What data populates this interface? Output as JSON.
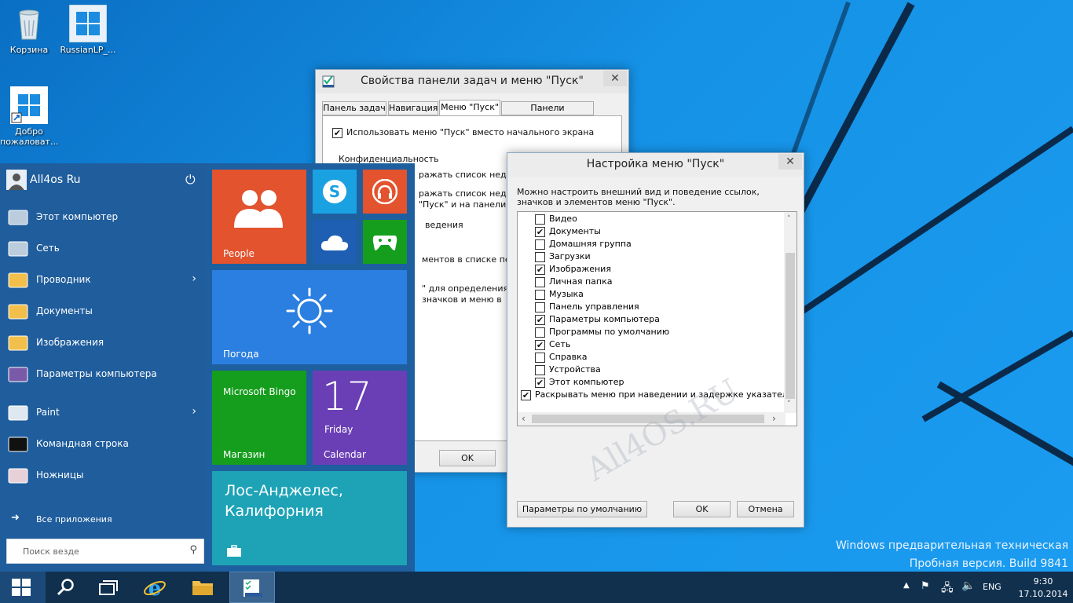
{
  "desktop": {
    "icons": [
      {
        "label": "Корзина"
      },
      {
        "label": "RussianLP_..."
      },
      {
        "label": "Добро пожаловат..."
      }
    ],
    "watermark_line1": "Windows предварительная техническая",
    "watermark_line2": "Пробная версия. Build 9841"
  },
  "taskbar_props": {
    "title": "Свойства панели задач и меню \"Пуск\"",
    "tabs": [
      "Панель задач",
      "Навигация",
      "Меню \"Пуск\"",
      "Панели инструментов"
    ],
    "use_start_menu": "Использовать меню \"Пуск\" вместо начального экрана",
    "privacy": "Конфиденциальность",
    "line1": "ражать список недавно",
    "line2": "ражать список недавно",
    "line3": "\"Пуск\" и на панели з",
    "line4": "ведения",
    "line5": "ментов в списке перех",
    "line6": "\" для определения вне",
    "line7": "значков и меню в",
    "ok": "OK"
  },
  "customize": {
    "title": "Настройка меню \"Пуск\"",
    "description": "Можно настроить внешний вид и поведение ссылок, значков и элементов меню \"Пуск\".",
    "items": [
      {
        "label": "Видео",
        "checked": false
      },
      {
        "label": "Документы",
        "checked": true
      },
      {
        "label": "Домашняя группа",
        "checked": false
      },
      {
        "label": "Загрузки",
        "checked": false
      },
      {
        "label": "Изображения",
        "checked": true
      },
      {
        "label": "Личная папка",
        "checked": false
      },
      {
        "label": "Музыка",
        "checked": false
      },
      {
        "label": "Панель управления",
        "checked": false
      },
      {
        "label": "Параметры компьютера",
        "checked": true
      },
      {
        "label": "Программы по умолчанию",
        "checked": false
      },
      {
        "label": "Сеть",
        "checked": true
      },
      {
        "label": "Справка",
        "checked": false
      },
      {
        "label": "Устройства",
        "checked": false
      },
      {
        "label": "Этот компьютер",
        "checked": true
      }
    ],
    "hover_option": "Раскрывать меню при наведении и задержке указателя мыши",
    "defaults_button": "Параметры по умолчанию",
    "ok": "OK",
    "cancel": "Отмена",
    "site_watermark": "All4OS.RU"
  },
  "start": {
    "user": "All4os Ru",
    "items": [
      {
        "label": "Этот компьютер",
        "arrow": false
      },
      {
        "label": "Сеть",
        "arrow": false
      },
      {
        "label": "Проводник",
        "arrow": true
      },
      {
        "label": "Документы",
        "arrow": false
      },
      {
        "label": "Изображения",
        "arrow": false
      },
      {
        "label": "Параметры компьютера",
        "arrow": false
      },
      {
        "label": "Paint",
        "arrow": true
      },
      {
        "label": "Командная строка",
        "arrow": false
      },
      {
        "label": "Ножницы",
        "arrow": false
      }
    ],
    "all_apps": "Все приложения",
    "search_placeholder": "Поиск везде",
    "tiles": {
      "people": "People",
      "weather": "Погода",
      "bingo_title": "Microsoft Bingo",
      "bingo_sub": "Магазин",
      "calendar_day": "17",
      "calendar_weekday": "Friday",
      "calendar_label": "Calendar",
      "travel_text": "Лос-Анджелес, Калифорния"
    }
  },
  "tray": {
    "lang": "ENG",
    "time": "9:30",
    "date": "17.10.2014"
  },
  "colors": {
    "people": "#e2532e",
    "skype": "#1aa1e1",
    "music": "#e2532e",
    "onedrive": "#1e5fb3",
    "xbox": "#159e1d",
    "weather": "#2b7fe0",
    "bingo": "#159e1d",
    "calendar": "#6a3fb5",
    "travel": "#1ea3b6"
  }
}
